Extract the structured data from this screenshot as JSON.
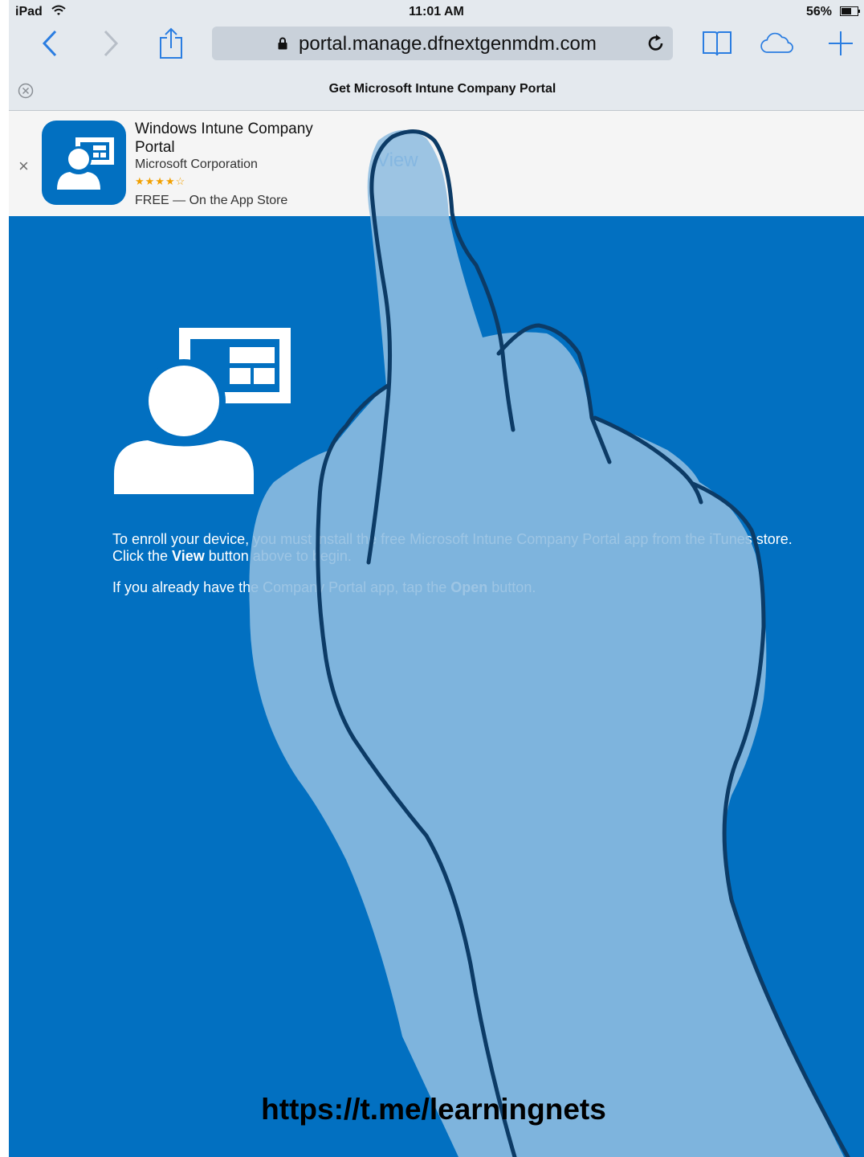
{
  "status_bar": {
    "carrier": "iPad",
    "time": "11:01 AM",
    "battery": "56%"
  },
  "browser": {
    "url": "portal.manage.dfnextgenmdm.com",
    "tab_title": "Get Microsoft Intune Company Portal",
    "icons": [
      "back-icon",
      "forward-icon",
      "share-icon",
      "lock-icon",
      "reload-icon",
      "bookmarks-icon",
      "icloud-tabs-icon",
      "new-tab-icon",
      "tab-close-icon"
    ]
  },
  "app_banner": {
    "close": "×",
    "name": "Windows Intune Company Portal",
    "developer": "Microsoft Corporation",
    "rating": "★★★★☆",
    "price": "FREE — On the App Store",
    "view_label": "View"
  },
  "page": {
    "enroll_prefix": "To enroll your device, you must install the free Microsoft Intune Company Portal app from the iTunes store. Click the ",
    "enroll_bold": "View",
    "enroll_suffix": " button above to begin.",
    "existing_prefix": "If you already have the Company Portal app, tap the ",
    "existing_bold": "Open",
    "existing_suffix": " button."
  },
  "watermark": "https://t.me/learningnets",
  "colors": {
    "page_blue": "#0270c1",
    "chrome_bg": "#e4e9ee",
    "accent": "#3a8ee6",
    "hand_fill": "#8fbde0",
    "hand_outline": "#0c3b66"
  }
}
